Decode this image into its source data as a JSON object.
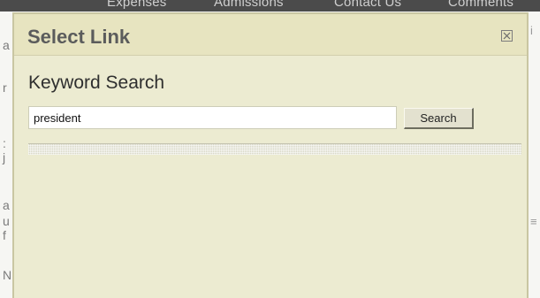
{
  "background_page": {
    "nav_items": [
      "Expenses",
      "Admissions",
      "Contact Us",
      "Comments"
    ],
    "left_fragments": [
      "a",
      "r",
      ":",
      "j",
      "a",
      "u",
      "f",
      "N"
    ],
    "right_fragments": [
      "i",
      "≡"
    ]
  },
  "modal": {
    "title": "Select Link",
    "close_icon": "close-box-icon",
    "section_heading": "Keyword Search",
    "search": {
      "value": "president",
      "placeholder": "",
      "button_label": "Search"
    }
  },
  "colors": {
    "modal_background": "#ecebd1",
    "modal_header": "#e7e4c0",
    "modal_border": "#c9c6a2",
    "nav_background": "#4b4b4b"
  }
}
